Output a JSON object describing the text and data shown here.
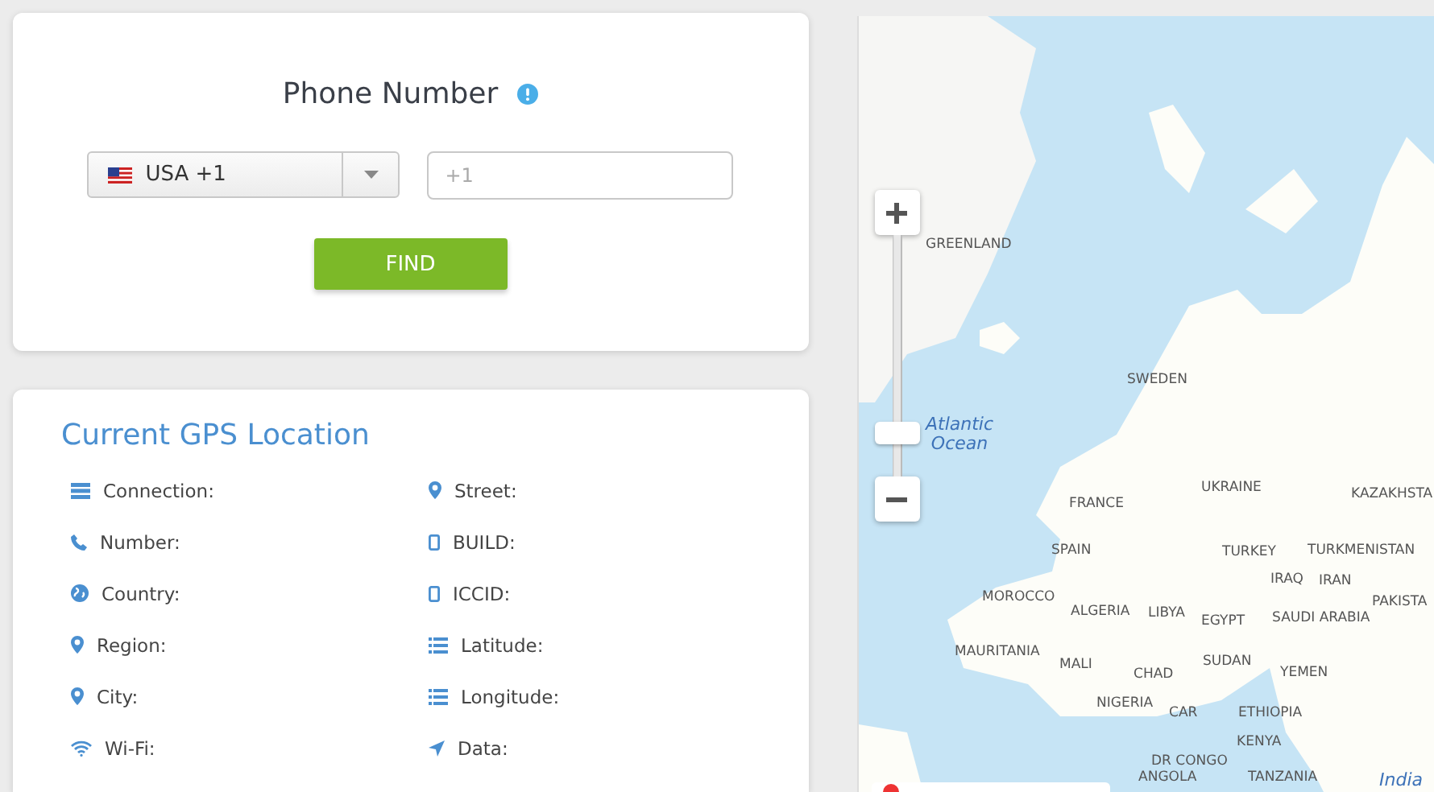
{
  "phone_card": {
    "title": "Phone Number",
    "country_select": {
      "value": "USA +1"
    },
    "phone_field": {
      "placeholder": "+1"
    },
    "find_button": "FIND"
  },
  "gps_card": {
    "title": "Current GPS Location",
    "fields": [
      {
        "label": "Connection:",
        "kind": "connection"
      },
      {
        "label": "Street:",
        "kind": "pin"
      },
      {
        "label": "Number:",
        "kind": "phone"
      },
      {
        "label": "BUILD:",
        "kind": "device"
      },
      {
        "label": "Country:",
        "kind": "globe"
      },
      {
        "label": "ICCID:",
        "kind": "device"
      },
      {
        "label": "Region:",
        "kind": "pin"
      },
      {
        "label": "Latitude:",
        "kind": "list"
      },
      {
        "label": "City:",
        "kind": "pin"
      },
      {
        "label": "Longitude:",
        "kind": "list"
      },
      {
        "label": "Wi-Fi:",
        "kind": "wifi"
      },
      {
        "label": "Data:",
        "kind": "arrow"
      }
    ]
  },
  "map": {
    "zoom": {
      "level": 0.15
    },
    "labels": [
      {
        "text": "GREENLAND",
        "kind": "country"
      },
      {
        "text": "SWEDEN",
        "kind": "country"
      },
      {
        "text": "Atlantic Ocean",
        "kind": "ocean"
      },
      {
        "text": "UKRAINE",
        "kind": "country"
      },
      {
        "text": "KAZAKHSTA",
        "kind": "country"
      },
      {
        "text": "FRANCE",
        "kind": "country"
      },
      {
        "text": "SPAIN",
        "kind": "country"
      },
      {
        "text": "TURKEY",
        "kind": "country"
      },
      {
        "text": "TURKMENISTAN",
        "kind": "country"
      },
      {
        "text": "IRAQ",
        "kind": "country"
      },
      {
        "text": "IRAN",
        "kind": "country"
      },
      {
        "text": "PAKISTA",
        "kind": "country"
      },
      {
        "text": "MOROCCO",
        "kind": "country"
      },
      {
        "text": "ALGERIA",
        "kind": "country"
      },
      {
        "text": "LIBYA",
        "kind": "country"
      },
      {
        "text": "EGYPT",
        "kind": "country"
      },
      {
        "text": "SAUDI ARABIA",
        "kind": "country"
      },
      {
        "text": "MAURITANIA",
        "kind": "country"
      },
      {
        "text": "MALI",
        "kind": "country"
      },
      {
        "text": "CHAD",
        "kind": "country"
      },
      {
        "text": "SUDAN",
        "kind": "country"
      },
      {
        "text": "YEMEN",
        "kind": "country"
      },
      {
        "text": "NIGERIA",
        "kind": "country"
      },
      {
        "text": "CAR",
        "kind": "country"
      },
      {
        "text": "ETHIOPIA",
        "kind": "country"
      },
      {
        "text": "KENYA",
        "kind": "country"
      },
      {
        "text": "DR CONGO",
        "kind": "country"
      },
      {
        "text": "ANGOLA",
        "kind": "country"
      },
      {
        "text": "TANZANIA",
        "kind": "country"
      },
      {
        "text": "India",
        "kind": "ocean"
      }
    ]
  }
}
